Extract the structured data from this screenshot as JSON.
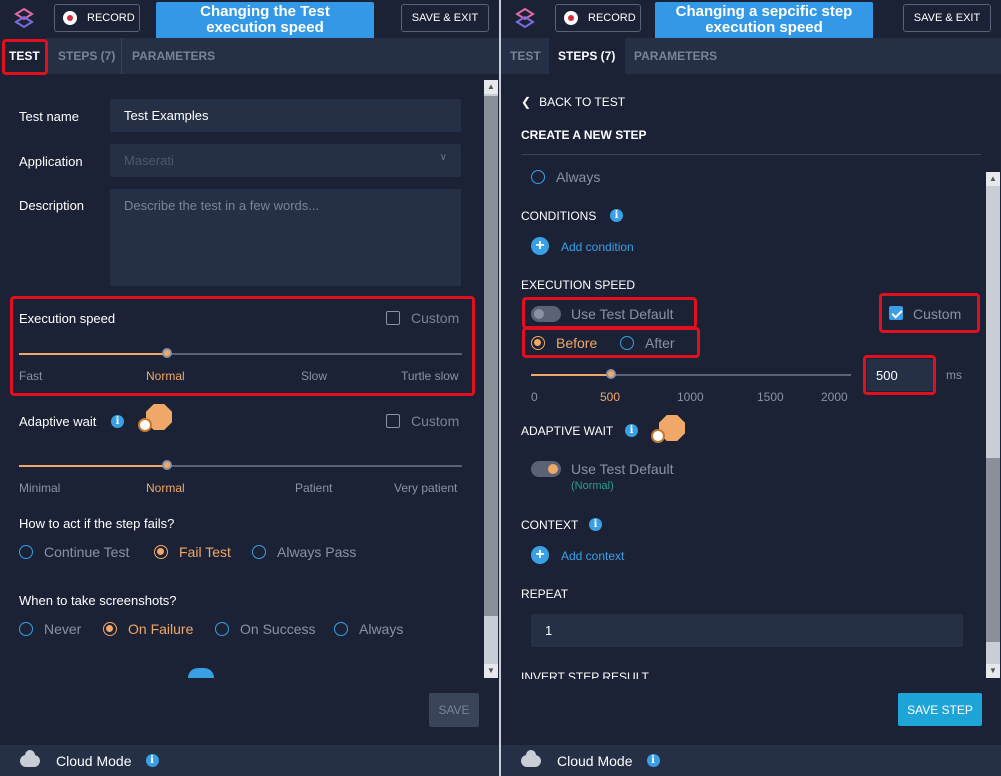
{
  "left": {
    "record_label": "RECORD",
    "callout": [
      "Changing the Test",
      "execution speed"
    ],
    "save_exit_label": "SAVE & EXIT",
    "tabs": [
      {
        "label": "TEST"
      },
      {
        "label": "STEPS (7)"
      },
      {
        "label": "PARAMETERS"
      }
    ],
    "test_name_label": "Test name",
    "test_name_value": "Test Examples",
    "application_label": "Application",
    "application_value": "Maserati",
    "description_label": "Description",
    "description_placeholder": "Describe the test in a few words...",
    "execution_speed": {
      "label": "Execution speed",
      "custom_label": "Custom",
      "custom_checked": false,
      "value_fraction": 0.333,
      "ticks": [
        "Fast",
        "Normal",
        "Slow",
        "Turtle slow"
      ],
      "selected": "Normal"
    },
    "adaptive_wait": {
      "label": "Adaptive wait",
      "custom_label": "Custom",
      "custom_checked": false,
      "value_fraction": 0.333,
      "ticks": [
        "Minimal",
        "Normal",
        "Patient",
        "Very patient"
      ],
      "selected": "Normal"
    },
    "fail_question": "How to act if the step fails?",
    "fail_options": [
      "Continue Test",
      "Fail Test",
      "Always Pass"
    ],
    "fail_selected": "Fail Test",
    "screenshot_question": "When to take screenshots?",
    "screenshot_options": [
      "Never",
      "On Failure",
      "On Success",
      "Always"
    ],
    "screenshot_selected": "On Failure",
    "save_label": "SAVE",
    "footer_label": "Cloud Mode"
  },
  "right": {
    "record_label": "RECORD",
    "callout": [
      "Changing a sepcific step",
      "execution speed"
    ],
    "save_exit_label": "SAVE & EXIT",
    "tabs": [
      {
        "label": "TEST"
      },
      {
        "label": "STEPS (7)"
      },
      {
        "label": "PARAMETERS"
      }
    ],
    "back_label": "BACK TO TEST",
    "create_title": "CREATE A NEW STEP",
    "always_label": "Always",
    "conditions_label": "CONDITIONS",
    "add_condition_label": "Add condition",
    "execution_speed_label": "EXECUTION SPEED",
    "use_test_default_label": "Use Test Default",
    "use_test_default_on": false,
    "custom_label": "Custom",
    "custom_checked": true,
    "before_label": "Before",
    "after_label": "After",
    "timing_selected": "Before",
    "speed_value": "500",
    "speed_unit": "ms",
    "speed_fraction": 0.25,
    "speed_ticks": [
      "0",
      "500",
      "1000",
      "1500",
      "2000"
    ],
    "speed_selected_tick": "500",
    "adaptive_wait_label": "ADAPTIVE WAIT",
    "adaptive_default_label": "Use Test Default",
    "adaptive_default_on": true,
    "adaptive_default_sub": "(Normal)",
    "context_label": "CONTEXT",
    "add_context_label": "Add context",
    "repeat_label": "REPEAT",
    "repeat_value": "1",
    "invert_label": "INVERT STEP RESULT",
    "save_step_label": "SAVE STEP",
    "footer_label": "Cloud Mode"
  },
  "colors": {
    "accent": "#3aa0e6",
    "selected": "#f0a868",
    "highlight": "#e0101f",
    "callout": "#3399e6",
    "background": "#1b2235"
  }
}
